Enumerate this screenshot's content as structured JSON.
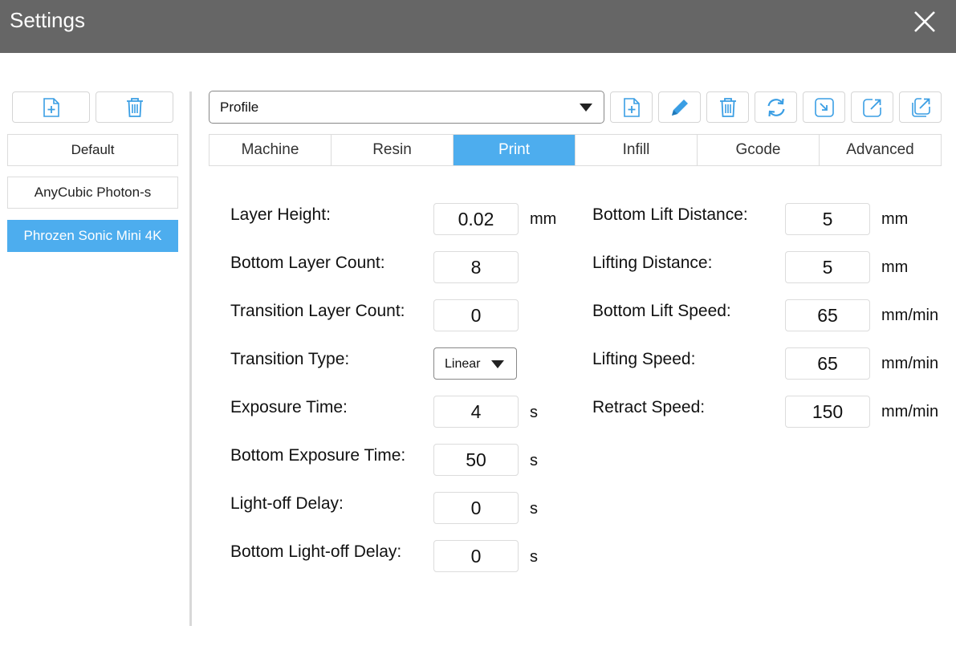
{
  "window": {
    "title": "Settings",
    "close_icon": "close-icon"
  },
  "sidebar": {
    "add_icon": "file-add-icon",
    "delete_icon": "trash-icon",
    "profiles": [
      "Default",
      "AnyCubic Photon-s",
      "Phrozen Sonic Mini 4K"
    ],
    "selected_profile": "Phrozen Sonic Mini 4K"
  },
  "toolbar": {
    "profile_select": "Profile",
    "icons": [
      "file-add-icon",
      "edit-pencil-icon",
      "trash-icon",
      "refresh-icon",
      "import-icon",
      "export-icon",
      "export-copy-icon"
    ],
    "accent_color": "#4dadee"
  },
  "tabs": [
    "Machine",
    "Resin",
    "Print",
    "Infill",
    "Gcode",
    "Advanced"
  ],
  "active_tab": "Print",
  "print": {
    "left": [
      {
        "label": "Layer Height:",
        "value": "0.02",
        "unit": "mm"
      },
      {
        "label": "Bottom Layer Count:",
        "value": "8",
        "unit": ""
      },
      {
        "label": "Transition Layer Count:",
        "value": "0",
        "unit": ""
      },
      {
        "label": "Transition Type:",
        "value": "Linear",
        "unit": ""
      },
      {
        "label": "Exposure Time:",
        "value": "4",
        "unit": "s"
      },
      {
        "label": "Bottom Exposure Time:",
        "value": "50",
        "unit": "s"
      },
      {
        "label": "Light-off Delay:",
        "value": "0",
        "unit": "s"
      },
      {
        "label": "Bottom Light-off Delay:",
        "value": "0",
        "unit": "s"
      }
    ],
    "right": [
      {
        "label": "Bottom Lift Distance:",
        "value": "5",
        "unit": "mm"
      },
      {
        "label": "Lifting Distance:",
        "value": "5",
        "unit": "mm"
      },
      {
        "label": "Bottom Lift Speed:",
        "value": "65",
        "unit": "mm/min"
      },
      {
        "label": "Lifting Speed:",
        "value": "65",
        "unit": "mm/min"
      },
      {
        "label": "Retract Speed:",
        "value": "150",
        "unit": "mm/min"
      }
    ]
  }
}
